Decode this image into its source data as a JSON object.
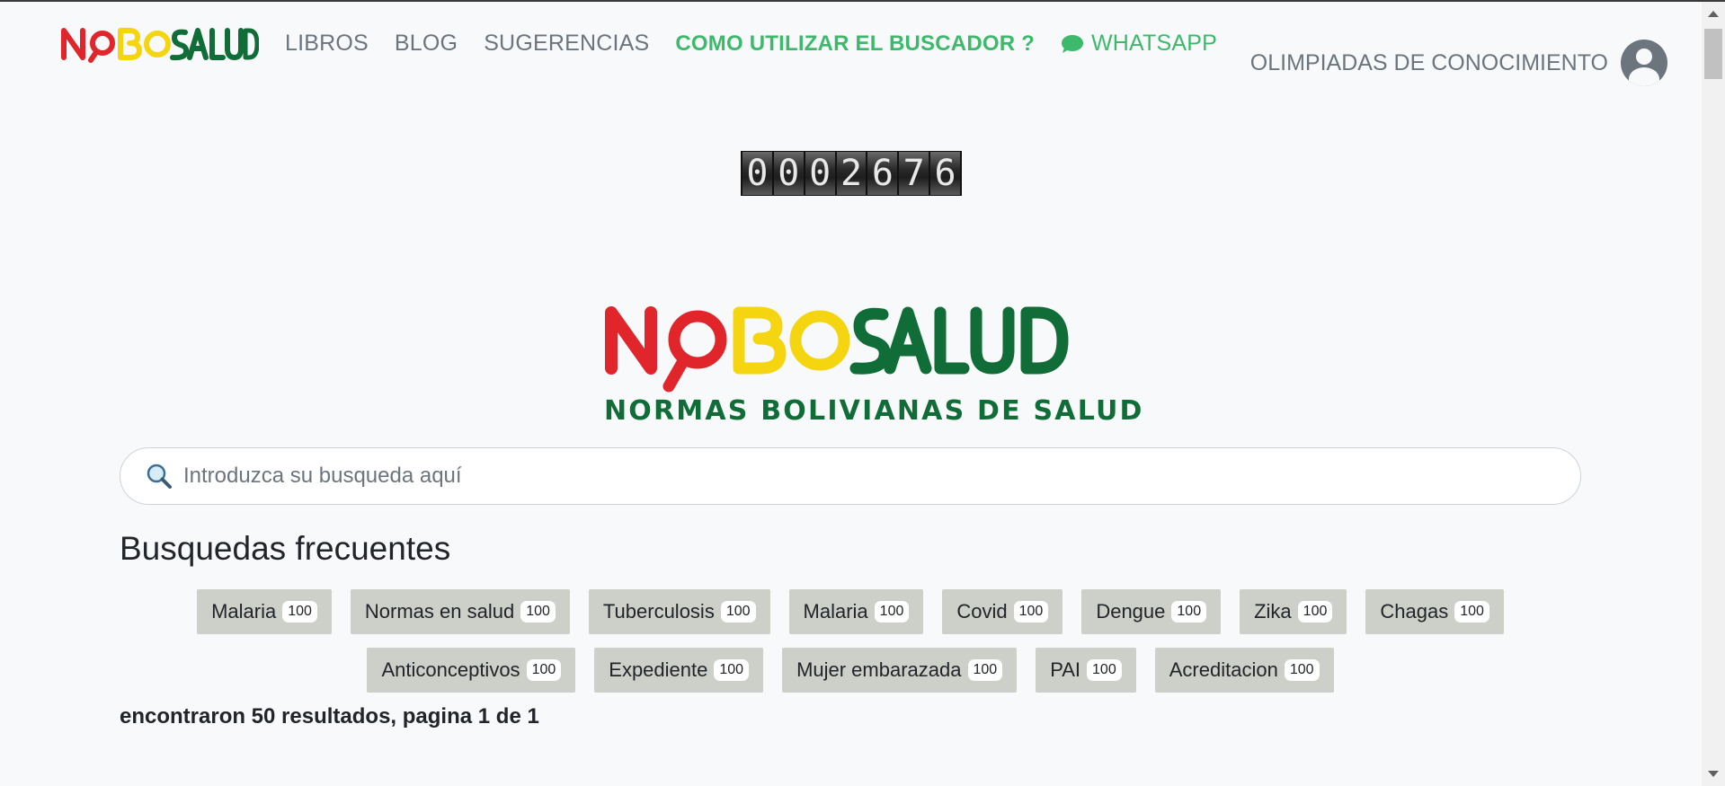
{
  "brand": {
    "logo_text": "NOBOSALUD",
    "tagline": "NORMAS BOLIVIANAS DE SALUD",
    "colors": {
      "red": "#e0262a",
      "yellow": "#f4d50f",
      "green": "#116d37"
    }
  },
  "nav": {
    "items": [
      {
        "label": "LIBROS"
      },
      {
        "label": "BLOG"
      },
      {
        "label": "SUGERENCIAS"
      },
      {
        "label": "COMO UTILIZAR EL BUSCADOR ?"
      },
      {
        "label": "WHATSAPP",
        "icon": "whatsapp-icon"
      }
    ],
    "user_label": "OLIMPIADAS DE CONOCIMIENTO",
    "accent": "#3cb96b"
  },
  "counter": {
    "digits": [
      "0",
      "0",
      "0",
      "2",
      "6",
      "7",
      "6"
    ]
  },
  "search": {
    "placeholder": "Introduzca su busqueda aquí",
    "value": "",
    "icon": "search-icon"
  },
  "frequent": {
    "title": "Busquedas frecuentes",
    "rows": [
      [
        {
          "label": "Malaria",
          "count": "100"
        },
        {
          "label": "Normas en salud",
          "count": "100"
        },
        {
          "label": "Tuberculosis",
          "count": "100"
        },
        {
          "label": "Malaria",
          "count": "100"
        },
        {
          "label": "Covid",
          "count": "100"
        },
        {
          "label": "Dengue",
          "count": "100"
        },
        {
          "label": "Zika",
          "count": "100"
        },
        {
          "label": "Chagas",
          "count": "100"
        }
      ],
      [
        {
          "label": "Anticonceptivos",
          "count": "100"
        },
        {
          "label": "Expediente",
          "count": "100"
        },
        {
          "label": "Mujer embarazada",
          "count": "100"
        },
        {
          "label": "PAI",
          "count": "100"
        },
        {
          "label": "Acreditacion",
          "count": "100"
        }
      ]
    ]
  },
  "results": {
    "text": "encontraron 50 resultados, pagina 1 de 1"
  }
}
